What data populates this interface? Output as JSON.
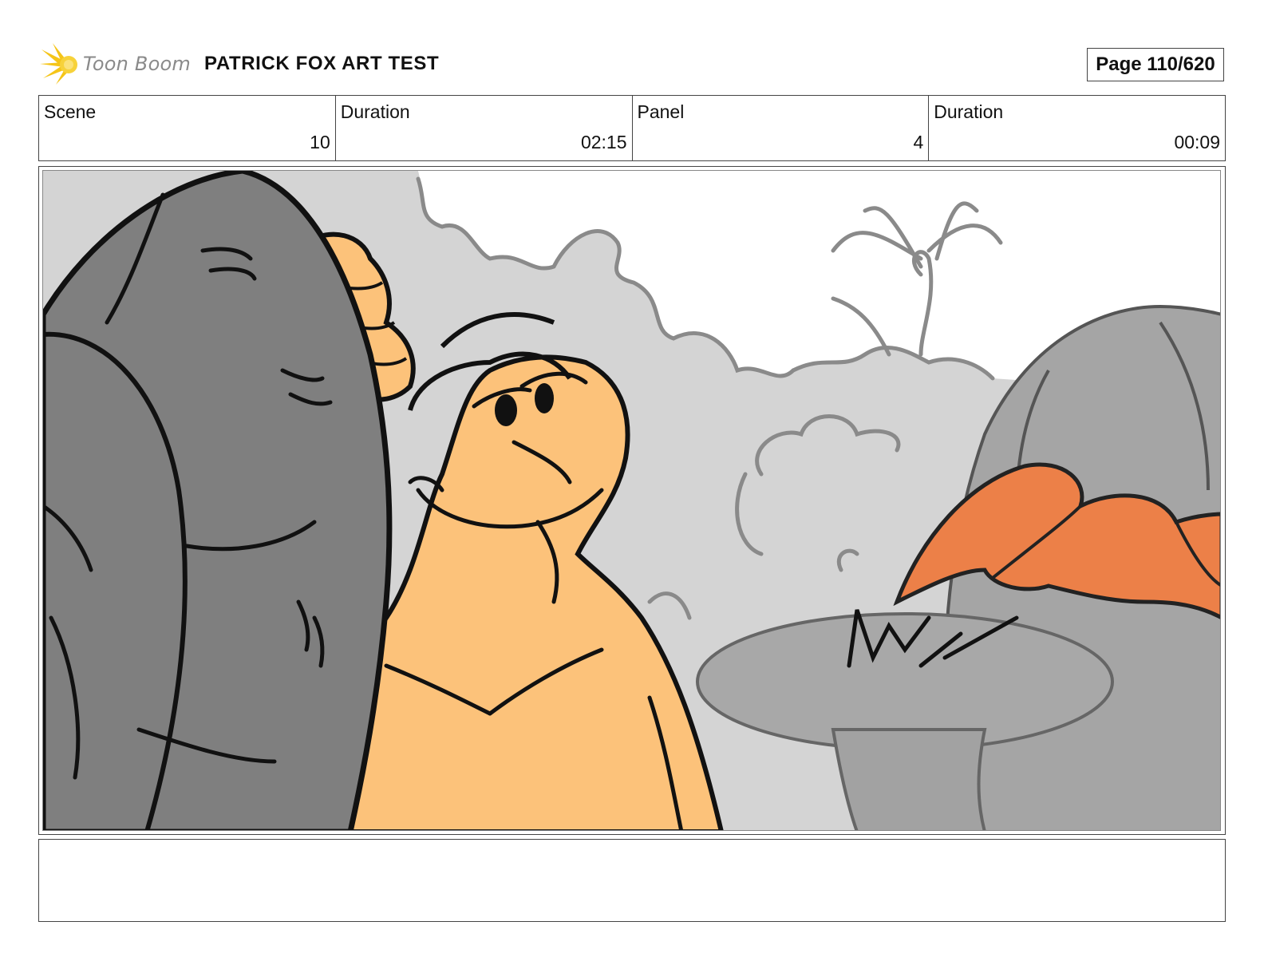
{
  "header": {
    "logo_text": "Toon Boom",
    "project_title": "PATRICK FOX ART TEST",
    "page_label": "Page 110/620"
  },
  "info": {
    "scene_label": "Scene",
    "scene_value": "10",
    "scene_duration_label": "Duration",
    "scene_duration_value": "02:15",
    "panel_label": "Panel",
    "panel_value": "4",
    "panel_duration_label": "Duration",
    "panel_duration_value": "00:09"
  },
  "panel": {
    "image_icon": "storyboard-drawing",
    "colors": {
      "background": "#d0d0d0",
      "rock": "#7f7f7f",
      "turtle_skin": "#fcc27a",
      "crab_claw": "#ec8048",
      "table": "#a8a8a8",
      "outline": "#111111"
    }
  },
  "notes": {
    "text": ""
  }
}
